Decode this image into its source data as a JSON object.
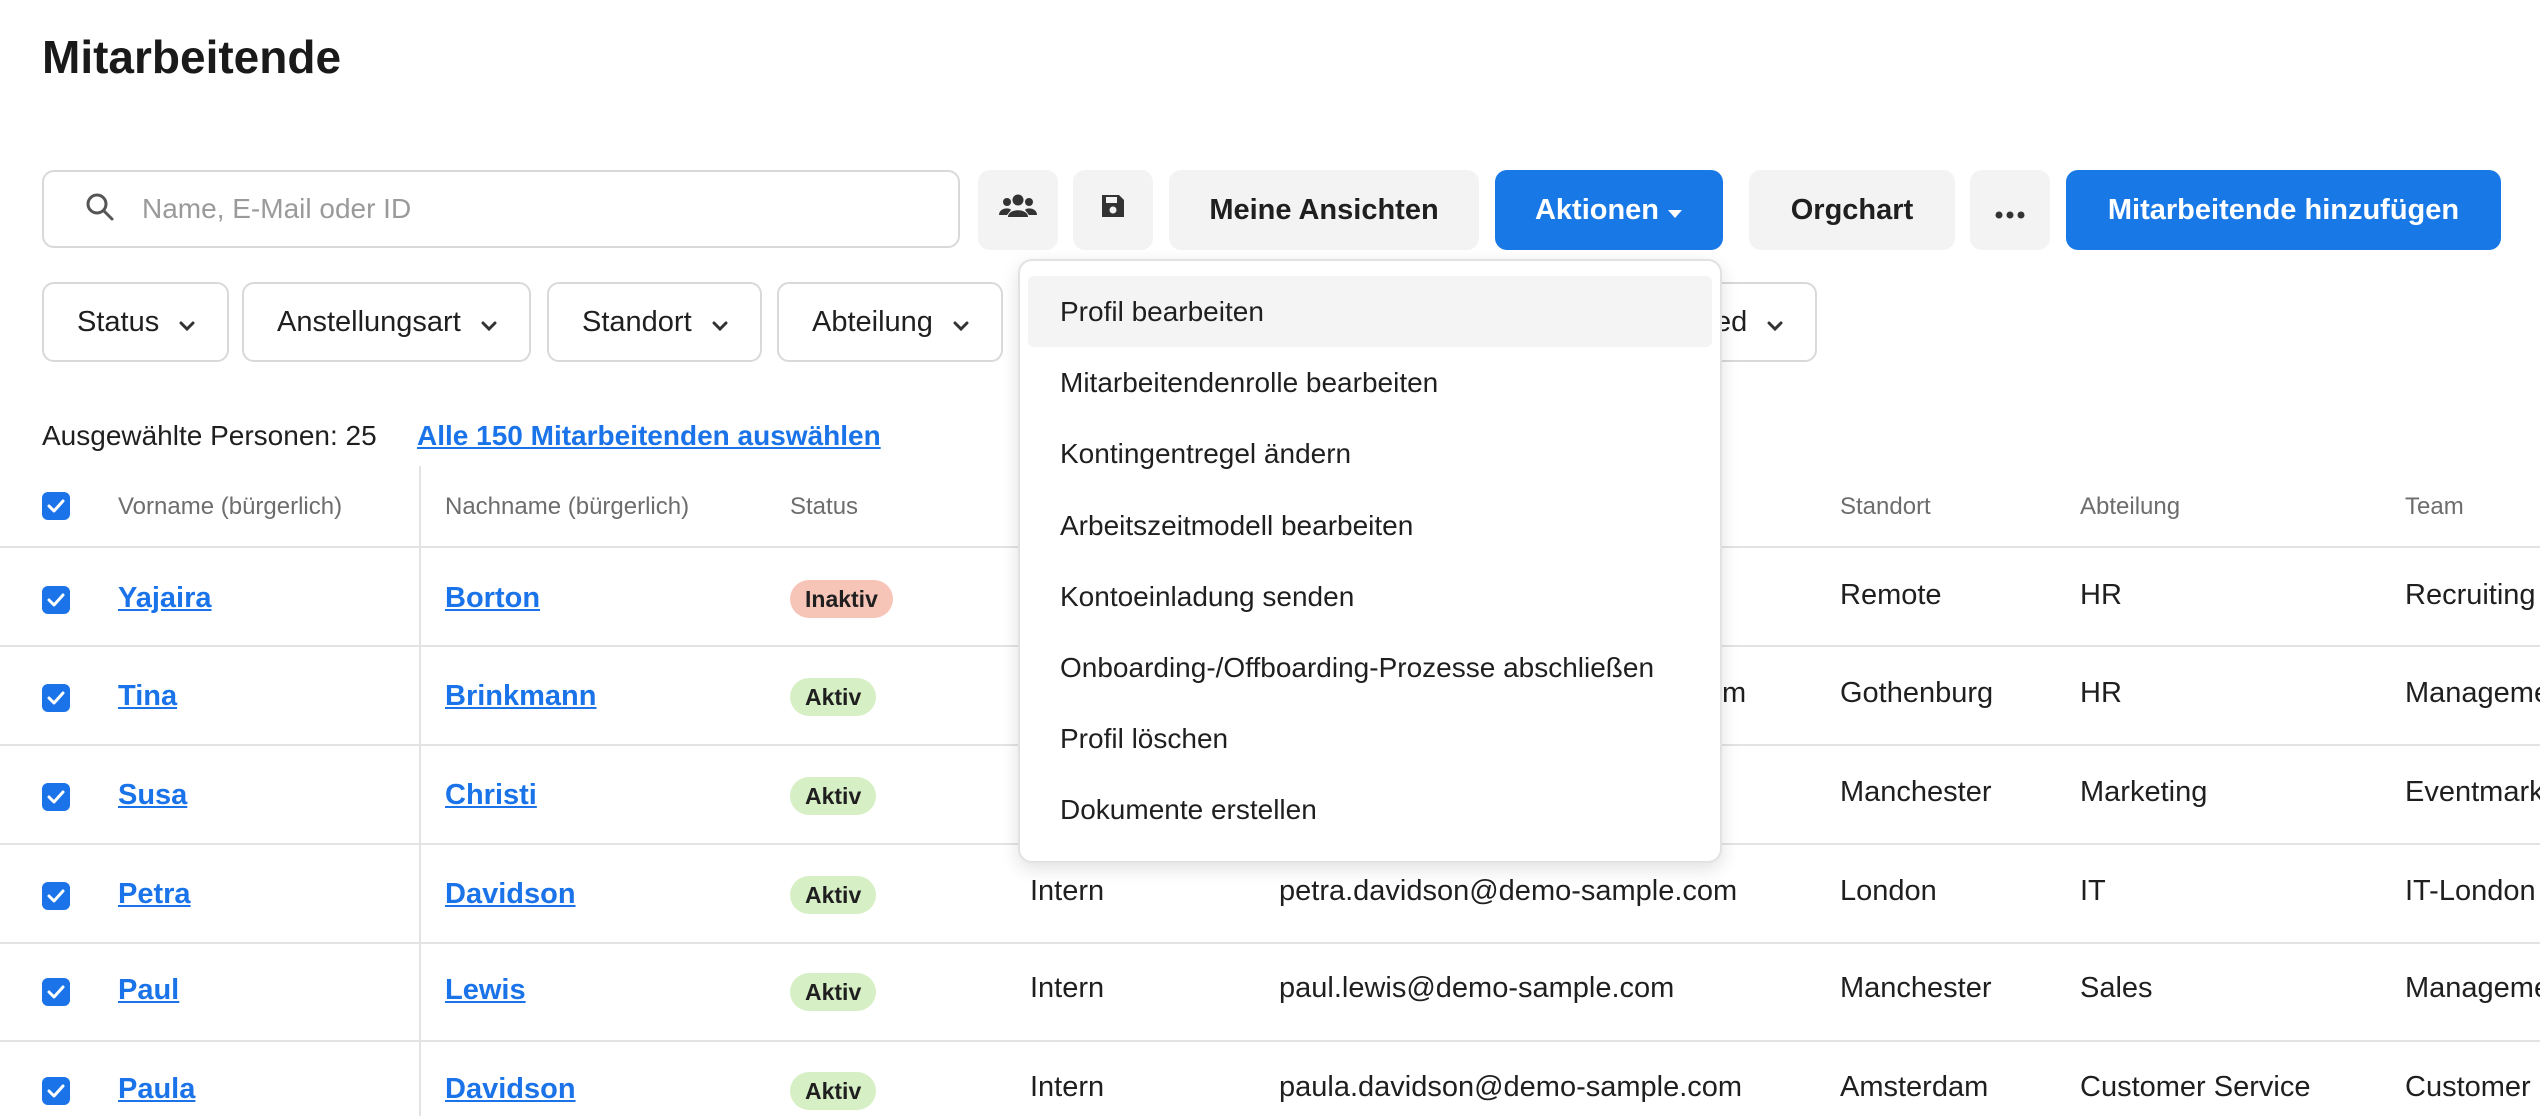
{
  "page": {
    "title": "Mitarbeitende"
  },
  "toolbar": {
    "search_placeholder": "Name, E-Mail oder ID",
    "my_views_label": "Meine Ansichten",
    "actions_label": "Aktionen",
    "orgchart_label": "Orgchart",
    "add_label": "Mitarbeitende hinzufügen"
  },
  "filters": [
    {
      "label": "Status"
    },
    {
      "label": "Anstellungsart"
    },
    {
      "label": "Standort"
    },
    {
      "label": "Abteilung"
    },
    {
      "label": "ed"
    }
  ],
  "selection": {
    "selected_label": "Ausgewählte Personen: 25",
    "select_all_label": "Alle 150 Mitarbeitenden auswählen"
  },
  "table": {
    "headers": {
      "first_name": "Vorname (bürgerlich)",
      "last_name": "Nachname (bürgerlich)",
      "status": "Status",
      "location": "Standort",
      "department": "Abteilung",
      "team": "Team"
    },
    "rows": [
      {
        "first": "Yajaira",
        "last": "Borton",
        "status": "Inaktiv",
        "type": "",
        "email": "",
        "location": "Remote",
        "department": "HR",
        "team": "Recruiting"
      },
      {
        "first": "Tina",
        "last": "Brinkmann",
        "status": "Aktiv",
        "type": "",
        "email": "m",
        "location": "Gothenburg",
        "department": "HR",
        "team": "Manageme"
      },
      {
        "first": "Susa",
        "last": "Christi",
        "status": "Aktiv",
        "type": "",
        "email": "",
        "location": "Manchester",
        "department": "Marketing",
        "team": "Eventmark"
      },
      {
        "first": "Petra",
        "last": "Davidson",
        "status": "Aktiv",
        "type": "Intern",
        "email": "petra.davidson@demo-sample.com",
        "location": "London",
        "department": "IT",
        "team": "IT-London"
      },
      {
        "first": "Paul",
        "last": "Lewis",
        "status": "Aktiv",
        "type": "Intern",
        "email": "paul.lewis@demo-sample.com",
        "location": "Manchester",
        "department": "Sales",
        "team": "Manageme"
      },
      {
        "first": "Paula",
        "last": "Davidson",
        "status": "Aktiv",
        "type": "Intern",
        "email": "paula.davidson@demo-sample.com",
        "location": "Amsterdam",
        "department": "Customer Service",
        "team": "Customer"
      }
    ]
  },
  "actions_menu": {
    "items": [
      {
        "label": "Profil bearbeiten"
      },
      {
        "label": "Mitarbeitendenrolle bearbeiten"
      },
      {
        "label": "Kontingentregel ändern"
      },
      {
        "label": "Arbeitszeitmodell bearbeiten"
      },
      {
        "label": "Kontoeinladung senden"
      },
      {
        "label": "Onboarding-/Offboarding-Prozesse abschließen"
      },
      {
        "label": "Profil löschen"
      },
      {
        "label": "Dokumente erstellen"
      }
    ]
  },
  "colors": {
    "primary": "#1878e6",
    "link": "#1a73e8",
    "active_badge": "#d6efc4",
    "inactive_badge": "#f7c4b8"
  }
}
